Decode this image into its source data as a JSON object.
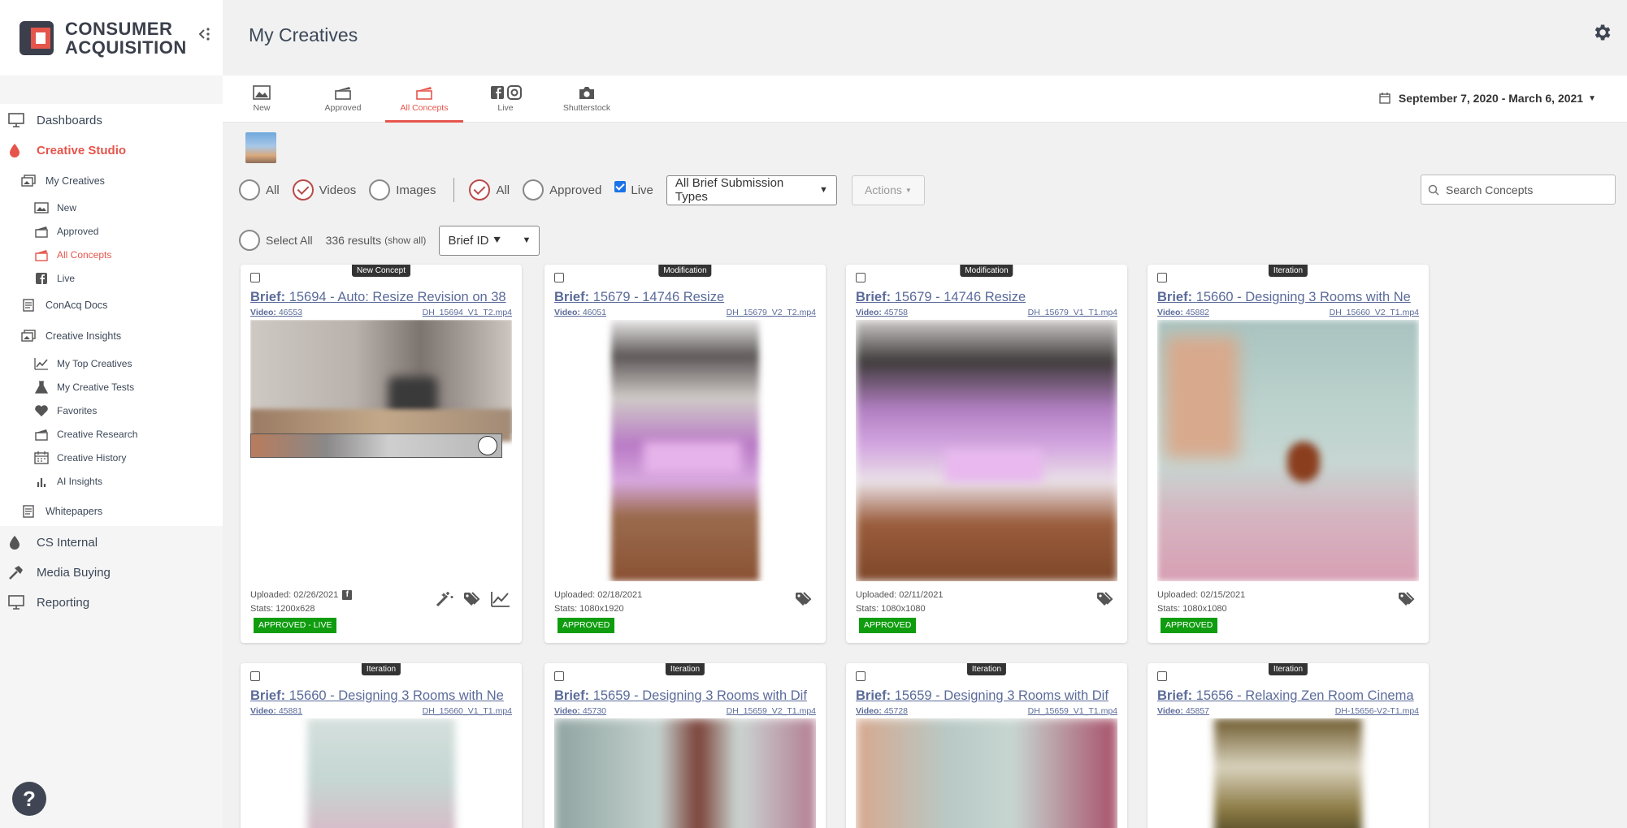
{
  "brand": {
    "line1": "CONSUMER",
    "line2": "ACQUISITION",
    "accent_color": "#e5554c"
  },
  "sidebar": {
    "items": [
      {
        "label": "Dashboards",
        "icon": "monitor-icon"
      },
      {
        "label": "Creative Studio",
        "icon": "drop-icon",
        "active": true
      },
      {
        "label": "My Creatives",
        "icon": "image-stack-icon"
      },
      {
        "label": "New",
        "icon": "image-icon"
      },
      {
        "label": "Approved",
        "icon": "clapper-icon"
      },
      {
        "label": "All Concepts",
        "icon": "clapper-icon",
        "active": true
      },
      {
        "label": "Live",
        "icon": "facebook-icon"
      },
      {
        "label": "ConAcq Docs",
        "icon": "document-icon"
      },
      {
        "label": "Creative Insights",
        "icon": "image-stack-icon"
      },
      {
        "label": "My Top Creatives",
        "icon": "line-chart-icon"
      },
      {
        "label": "My Creative Tests",
        "icon": "flask-icon"
      },
      {
        "label": "Favorites",
        "icon": "heart-icon"
      },
      {
        "label": "Creative Research",
        "icon": "clapper-icon"
      },
      {
        "label": "Creative History",
        "icon": "calendar-icon"
      },
      {
        "label": "AI Insights",
        "icon": "bar-chart-icon"
      },
      {
        "label": "Whitepapers",
        "icon": "document-icon"
      },
      {
        "label": "CS Internal",
        "icon": "drop-icon"
      },
      {
        "label": "Media Buying",
        "icon": "hammer-icon"
      },
      {
        "label": "Reporting",
        "icon": "monitor-icon"
      }
    ],
    "help": "?"
  },
  "header": {
    "title": "My Creatives"
  },
  "tabs": [
    {
      "label": "New",
      "icon": "image-icon"
    },
    {
      "label": "Approved",
      "icon": "clapper-icon"
    },
    {
      "label": "All Concepts",
      "icon": "clapper-icon",
      "active": true
    },
    {
      "label": "Live",
      "icon": "facebook-instagram-icon"
    },
    {
      "label": "Shutterstock",
      "icon": "camera-icon"
    }
  ],
  "date_range": "September 7, 2020 - March 6, 2021",
  "filters": {
    "media": [
      "All",
      "Videos",
      "Images"
    ],
    "media_selected": "Videos",
    "status": [
      "All",
      "Approved"
    ],
    "status_selected": "All",
    "live_label": "Live",
    "brief_type": "All Brief Submission Types",
    "actions": "Actions",
    "search_placeholder": "Search Concepts"
  },
  "results": {
    "select_all": "Select All",
    "count": "336 results",
    "show_all": "(show all)",
    "sort": "Brief ID ⯆"
  },
  "cards": [
    {
      "badge": "New Concept",
      "brief_label": "Brief:",
      "brief": "15694 - Auto: Resize Revision on 38",
      "video_label": "Video:",
      "video": "46553",
      "file": "DH_15694_V1_T2.mp4",
      "uploaded": "Uploaded: 02/26/2021",
      "stats": "Stats: 1200x628",
      "status": "APPROVED - LIVE"
    },
    {
      "badge": "Modification",
      "brief_label": "Brief:",
      "brief": "15679 - 14746 Resize",
      "video_label": "Video:",
      "video": "46051",
      "file": "DH_15679_V2_T2.mp4",
      "uploaded": "Uploaded: 02/18/2021",
      "stats": "Stats: 1080x1920",
      "status": "APPROVED"
    },
    {
      "badge": "Modification",
      "brief_label": "Brief:",
      "brief": "15679 - 14746 Resize",
      "video_label": "Video:",
      "video": "45758",
      "file": "DH_15679_V1_T1.mp4",
      "uploaded": "Uploaded: 02/11/2021",
      "stats": "Stats: 1080x1080",
      "status": "APPROVED"
    },
    {
      "badge": "Iteration",
      "brief_label": "Brief:",
      "brief": "15660 - Designing 3 Rooms with Ne",
      "video_label": "Video:",
      "video": "45882",
      "file": "DH_15660_V2_T1.mp4",
      "uploaded": "Uploaded: 02/15/2021",
      "stats": "Stats: 1080x1080",
      "status": "APPROVED"
    },
    {
      "badge": "Iteration",
      "brief_label": "Brief:",
      "brief": "15660 - Designing 3 Rooms with Ne",
      "video_label": "Video:",
      "video": "45881",
      "file": "DH_15660_V1_T1.mp4"
    },
    {
      "badge": "Iteration",
      "brief_label": "Brief:",
      "brief": "15659 - Designing 3 Rooms with Dif",
      "video_label": "Video:",
      "video": "45730",
      "file": "DH_15659_V2_T1.mp4"
    },
    {
      "badge": "Iteration",
      "brief_label": "Brief:",
      "brief": "15659 - Designing 3 Rooms with Dif",
      "video_label": "Video:",
      "video": "45728",
      "file": "DH_15659_V1_T1.mp4"
    },
    {
      "badge": "Iteration",
      "brief_label": "Brief:",
      "brief": "15656 - Relaxing Zen Room Cinema",
      "video_label": "Video:",
      "video": "45857",
      "file": "DH-15656-V2-T1.mp4"
    }
  ]
}
